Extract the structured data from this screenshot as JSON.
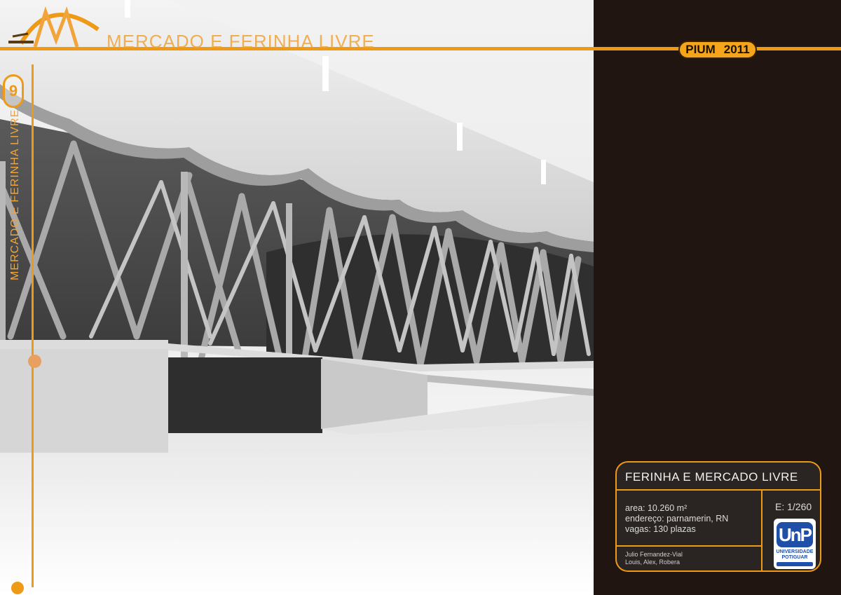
{
  "header": {
    "title": "MERCADO E FERINHA LIVRE",
    "badge_text": "PIUM",
    "badge_year": "2011",
    "accent_color": "#ef9a17"
  },
  "sidebar": {
    "vertical_title": "MERCADO E FERINHA LIVRE",
    "page_number": "9"
  },
  "render": {
    "icon": "architectural-render-image"
  },
  "info": {
    "title": "FERINHA E MERCADO LIVRE",
    "area": "area: 10.260 m²",
    "address": "endereço:  parnamerin, RN",
    "spaces": "vagas:  130 plazas",
    "author_1": "Julio Fernandez-Vial",
    "author_2": "Louis, Alex, Robera",
    "scale": "E: 1/260",
    "university_mark": "UnP",
    "university_line_1": "UNIVERSIDADE",
    "university_line_2": "POTIGUAR"
  }
}
